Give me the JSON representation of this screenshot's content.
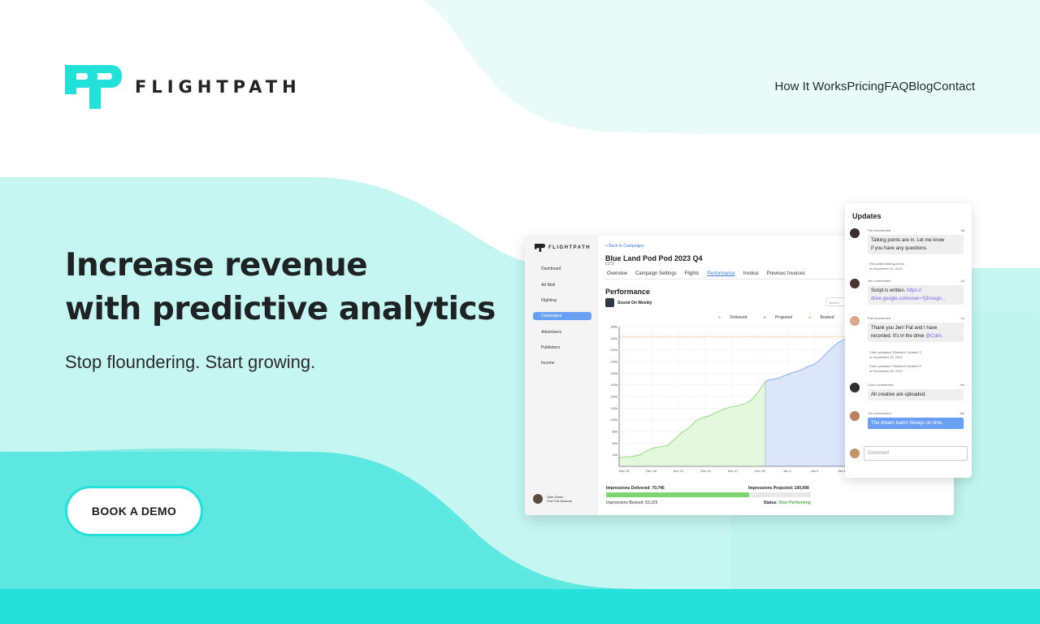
{
  "brand": {
    "name": "FLIGHTPATH",
    "accent": "#22e1d8"
  },
  "nav": [
    "How It Works",
    "Pricing",
    "FAQ",
    "Blog",
    "Contact"
  ],
  "hero": {
    "title_line1": "Increase revenue",
    "title_line2": "with predictive analytics",
    "subtitle": "Stop floundering. Start growing.",
    "cta": "BOOK A DEMO"
  },
  "app": {
    "logo": "FLIGHTPATH",
    "sidebar": [
      "Dashboard",
      "Ad Wall",
      "Flighting",
      "Campaigns",
      "Advertisers",
      "Publishers",
      "Income"
    ],
    "sidebar_active": "Campaigns",
    "user": {
      "name": "Sam Green",
      "org": "Pod Pod Network"
    },
    "back_link": "< Back to Campaigns",
    "campaign_title": "Blue Land Pod Pod 2023 Q4",
    "campaign_id": "c172",
    "tabs": [
      "Overview",
      "Campaign Settings",
      "Flights",
      "Performance",
      "Invoice",
      "Previous Invoices"
    ],
    "active_tab": "Performance",
    "section_title": "Performance",
    "podcast": "Sound On Weekly",
    "search_placeholder": "Search",
    "legend": [
      "Delivered",
      "Projected",
      "Booked"
    ],
    "impressions_delivered": "Impressions Delivered: 70,745",
    "impressions_projected": "Impressions Projected: 100,000",
    "impressions_booked": "Impressions Booked: 63,225",
    "status_label": "Status:",
    "status_value": "Over Performing",
    "delivered_progress": 0.7
  },
  "chart_data": {
    "type": "area",
    "x": [
      "Dec 15",
      "Dec 18",
      "Dec 21",
      "Dec 24",
      "Dec 27",
      "Dec 30",
      "Jan 2",
      "Jan 5",
      "Jan 8"
    ],
    "yticks": [
      "40k",
      "60k",
      "80k",
      "100k",
      "120k",
      "140k",
      "160k",
      "180k",
      "200k",
      "220k",
      "240k",
      "260k"
    ],
    "ylim": [
      20000,
      260000
    ],
    "booked_line": 243000,
    "series": [
      {
        "name": "Delivered",
        "values": [
          35000,
          36000,
          37000,
          40000,
          47000,
          52000,
          54000,
          56000,
          67000,
          78000,
          86000,
          98000,
          104000,
          107000,
          113000,
          118000,
          122000,
          124000,
          127000,
          134000,
          148000,
          166000
        ]
      },
      {
        "name": "Projected",
        "values": [
          166000,
          169000,
          170000,
          172000,
          175000,
          178000,
          181000,
          183000,
          186000,
          190000,
          193000,
          196000,
          202000,
          210000,
          218000,
          225000,
          232000,
          236000,
          240000
        ]
      }
    ]
  },
  "updates": {
    "title": "Updates",
    "messages": [
      {
        "who": "Pat commented",
        "ago": "3d",
        "l1": "Talking points are in. Let me know",
        "l2": "if you have any questions."
      },
      {
        "who": "Jen commented",
        "ago": "2d",
        "l1": "Script is written. ",
        "link1": "https://",
        "link2": "drive.google.com/user=?j3nsogn..."
      },
      {
        "who": "Pat commented",
        "ago": "1d",
        "l1": "Thank you Jen! Pat and I have",
        "l2": "recorded. It's in the drive ",
        "mention": "@Colin."
      },
      {
        "who": "Colin commented",
        "ago": "5m",
        "l1": "All creative are uploaded."
      },
      {
        "who": "You commented",
        "ago": "5m",
        "l1": "The dream team! Always on time."
      }
    ],
    "notes": [
      {
        "l1": "Pat added talking points",
        "l2": "on November 22, 2022"
      },
      {
        "l1": "Colin uploaded \"Bluebird Creative 1\"",
        "l2": "on November 25, 2022"
      },
      {
        "l1": "Colin uploaded \"Bluebird Creative 2\"",
        "l2": "on November 25, 2022"
      }
    ],
    "comment_placeholder": "Comment"
  }
}
